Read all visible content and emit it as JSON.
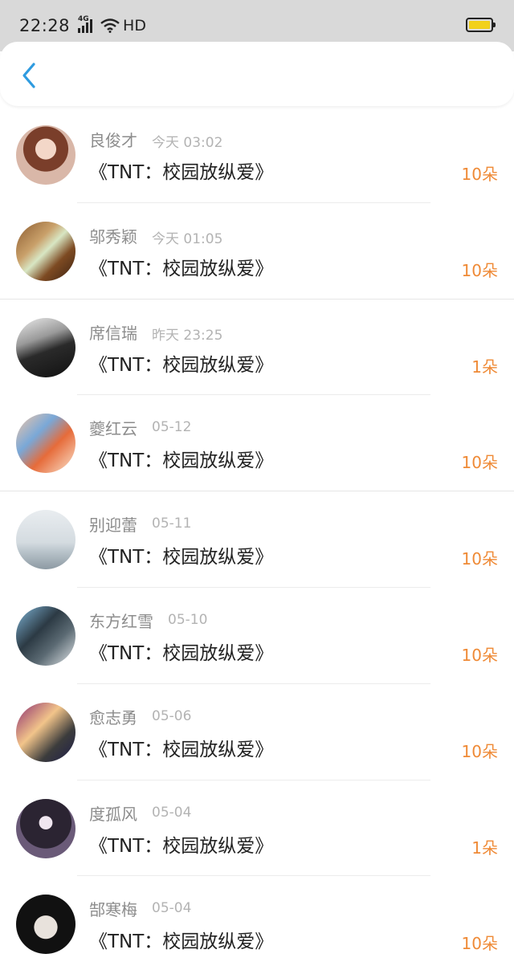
{
  "status_bar": {
    "time": "22:28",
    "network": "4G",
    "hd": "HD",
    "battery_color": "#f2d11b",
    "icons": [
      "signal-icon",
      "wifi-icon",
      "battery-icon"
    ]
  },
  "header": {
    "back_icon": "chevron-left-icon",
    "accent_color": "#2e9be0"
  },
  "colors": {
    "count": "#ef8a36",
    "name": "#8c8c8c",
    "time": "#b3b3b3"
  },
  "records": [
    {
      "name": "良俊才",
      "time": "今天 03:02",
      "title": "《TNT：校园放纵爱》",
      "count": "10朵"
    },
    {
      "name": "邬秀颖",
      "time": "今天 01:05",
      "title": "《TNT：校园放纵爱》",
      "count": "10朵"
    },
    {
      "name": "席信瑞",
      "time": "昨天 23:25",
      "title": "《TNT：校园放纵爱》",
      "count": "1朵"
    },
    {
      "name": "夔红云",
      "time": "05-12",
      "title": "《TNT：校园放纵爱》",
      "count": "10朵"
    },
    {
      "name": "别迎蕾",
      "time": "05-11",
      "title": "《TNT：校园放纵爱》",
      "count": "10朵"
    },
    {
      "name": "东方红雪",
      "time": "05-10",
      "title": "《TNT：校园放纵爱》",
      "count": "10朵"
    },
    {
      "name": "愈志勇",
      "time": "05-06",
      "title": "《TNT：校园放纵爱》",
      "count": "10朵"
    },
    {
      "name": "度孤风",
      "time": "05-04",
      "title": "《TNT：校园放纵爱》",
      "count": "1朵"
    },
    {
      "name": "郜寒梅",
      "time": "05-04",
      "title": "《TNT：校园放纵爱》",
      "count": "10朵"
    }
  ]
}
